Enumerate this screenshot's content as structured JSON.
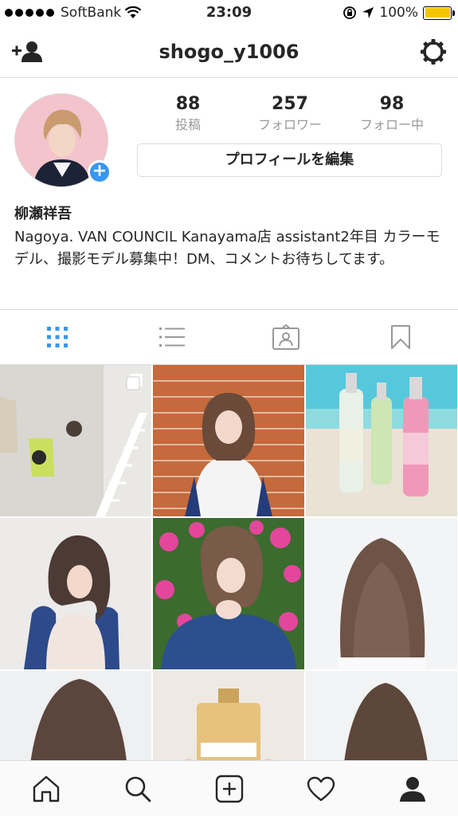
{
  "status_bar": {
    "carrier": "SoftBank",
    "time": "23:09",
    "battery": "100%",
    "icons": [
      "signal-dots-icon",
      "wifi-icon",
      "orientation-lock-icon",
      "location-icon",
      "battery-icon"
    ],
    "battery_color": "#f5c400"
  },
  "header": {
    "username": "shogo_y1006",
    "left_icon": "add-user-icon",
    "right_icon": "gear-icon"
  },
  "profile": {
    "stats": [
      {
        "num": "88",
        "label": "投稿"
      },
      {
        "num": "257",
        "label": "フォロワー"
      },
      {
        "num": "98",
        "label": "フォロー中"
      }
    ],
    "edit_button": "プロフィールを編集",
    "name": "柳瀬祥吾",
    "bio": "Nagoya. VAN COUNCIL Kanayama店 assistant2年目 カラーモデル、撮影モデル募集中！DM、コメントお待ちしてます。",
    "badge_color": "#3897f0"
  },
  "tabs": [
    {
      "icon": "grid-icon",
      "active": true
    },
    {
      "icon": "list-icon",
      "active": false
    },
    {
      "icon": "tagged-photo-icon",
      "active": false
    },
    {
      "icon": "bookmark-icon",
      "active": false
    }
  ],
  "accent_color": "#3897f0",
  "grid": {
    "posts": [
      {
        "subject": "hallway-bags-ladder",
        "multi": true
      },
      {
        "subject": "girl-brick-wall"
      },
      {
        "subject": "bottles-on-beach"
      },
      {
        "subject": "girl-white-cami"
      },
      {
        "subject": "girl-pink-flowers"
      },
      {
        "subject": "hair-back-brown"
      },
      {
        "subject": "hair-back-1"
      },
      {
        "subject": "perfume-bottle"
      },
      {
        "subject": "hair-back-2"
      }
    ]
  },
  "bottom_nav": [
    {
      "icon": "home-icon"
    },
    {
      "icon": "search-icon"
    },
    {
      "icon": "add-post-icon"
    },
    {
      "icon": "heart-icon"
    },
    {
      "icon": "profile-icon",
      "active": true
    }
  ]
}
